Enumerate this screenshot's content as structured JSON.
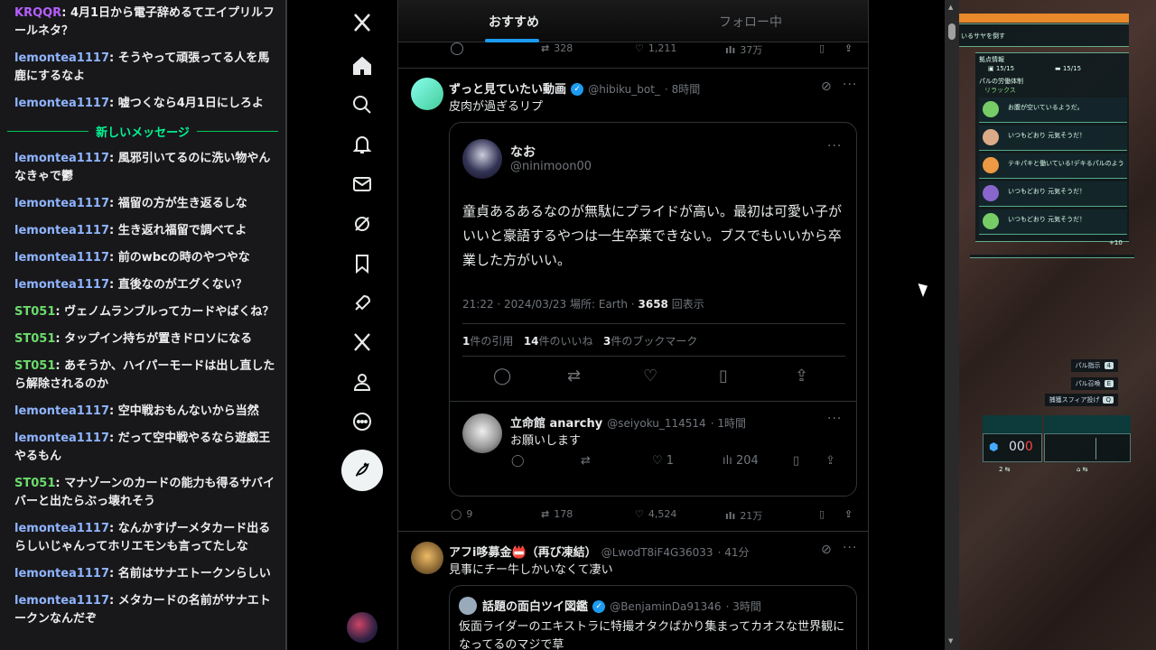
{
  "chat": {
    "messages": [
      {
        "user": "KRQQR",
        "color": "#b65eff",
        "text": "4月1日から電子辞めるてエイプリルフールネタ？"
      },
      {
        "user": "lemontea1117",
        "color": "#8fb4ff",
        "text": "そうやって頑張ってる人を馬鹿にするなよ"
      },
      {
        "user": "lemontea1117",
        "color": "#8fb4ff",
        "text": "嘘つくなら4月1日にしろよ"
      }
    ],
    "separator": "新しいメッセージ",
    "new_messages": [
      {
        "user": "lemontea1117",
        "color": "#8fb4ff",
        "text": "風邪引いてるのに洗い物やんなきゃで鬱"
      },
      {
        "user": "lemontea1117",
        "color": "#8fb4ff",
        "text": "福留の方が生き返るしな"
      },
      {
        "user": "lemontea1117",
        "color": "#8fb4ff",
        "text": "生き返れ福留で調べてよ"
      },
      {
        "user": "lemontea1117",
        "color": "#8fb4ff",
        "text": "前のwbcの時のやつやな"
      },
      {
        "user": "lemontea1117",
        "color": "#8fb4ff",
        "text": "直後なのがエグくない？"
      },
      {
        "user": "ST051",
        "color": "#6cdb6c",
        "text": "ヴェノムランブルってカードやばくね？"
      },
      {
        "user": "ST051",
        "color": "#6cdb6c",
        "text": "タップイン持ちが置きドロソになる"
      },
      {
        "user": "ST051",
        "color": "#6cdb6c",
        "text": "あそうか、ハイパーモードは出し直したら解除されるのか"
      },
      {
        "user": "lemontea1117",
        "color": "#8fb4ff",
        "text": "空中戦おもんないから当然"
      },
      {
        "user": "lemontea1117",
        "color": "#8fb4ff",
        "text": "だって空中戦やるなら遊戯王やるもん"
      },
      {
        "user": "ST051",
        "color": "#6cdb6c",
        "text": "マナゾーンのカードの能力も得るサバイバーと出たらぶっ壊れそう"
      },
      {
        "user": "lemontea1117",
        "color": "#8fb4ff",
        "text": "なんかすげーメタカード出るらしいじゃんってホリエモンも言ってたしな"
      },
      {
        "user": "lemontea1117",
        "color": "#8fb4ff",
        "text": "名前はサナエトークンらしい"
      },
      {
        "user": "lemontea1117",
        "color": "#8fb4ff",
        "text": "メタカードの名前がサナエトークンなんだぞ"
      }
    ]
  },
  "tabs": {
    "recommended": "おすすめ",
    "following": "フォロー中"
  },
  "top_actions": {
    "retweets": "328",
    "likes": "1,211",
    "views": "37万"
  },
  "tweet1": {
    "name": "ずっと見ていたい動画",
    "handle": "@hibiku_bot_",
    "time": "· 8時間",
    "text": "皮肉が過ぎるリプ",
    "quoted": {
      "name": "なお",
      "handle": "@ninimoon00",
      "body": "童貞あるあるなのが無駄にプライドが高い。最初は可愛い子がいいと豪語するやつは一生卒業できない。ブスでもいいから卒業した方がいい。",
      "meta_time": "21:22 · 2024/03/23 場所: Earth · ",
      "meta_views": "3658",
      "meta_views_label": " 回表示",
      "quotes_n": "1",
      "quotes_label": "件の引用",
      "likes_n": "14",
      "likes_label": "件のいいね",
      "bm_n": "3",
      "bm_label": "件のブックマーク",
      "reply": {
        "name": "立命館 anarchy",
        "handle": "@seiyoku_114514",
        "time": "· 1時間",
        "text": "お願いします",
        "likes": "1",
        "views": "204"
      }
    },
    "replies": "9",
    "retweets": "178",
    "likes": "4,524",
    "views": "21万"
  },
  "tweet2": {
    "name": "アフi哆募金📛（再び凍結）",
    "handle": "@LwodT8iF4G36033",
    "time": "· 41分",
    "text": "見事にチー牛しかいなくて凄い",
    "quoted": {
      "name": "話題の面白ツイ図鑑",
      "handle": "@BenjaminDa91346",
      "time": "· 3時間",
      "body": "仮面ライダーのエキストラに特撮オタクばかり集まってカオスな世界観になってるのマジで草"
    }
  },
  "game": {
    "mission": "いるサヤを倒す",
    "base_title": "拠点情報",
    "count1": "15/15",
    "count2": "15/15",
    "work_label": "パルの労働体制",
    "mode": "リラックス",
    "statuses": [
      "お腹が空いているようだ。",
      "いつもどおり 元気そうだ！",
      "テキパキと働いている!デキるパルのよう",
      "いつもどおり 元気そうだ！",
      "いつもどおり 元気そうだ！"
    ],
    "more": "+10",
    "btn_command": "パル指示",
    "key_command": "4",
    "btn_summon": "パル召喚",
    "key_summon": "E",
    "btn_throw": "捕獲スフィア投げ",
    "key_throw": "Q",
    "ammo": "00",
    "ammo_red": "0"
  }
}
